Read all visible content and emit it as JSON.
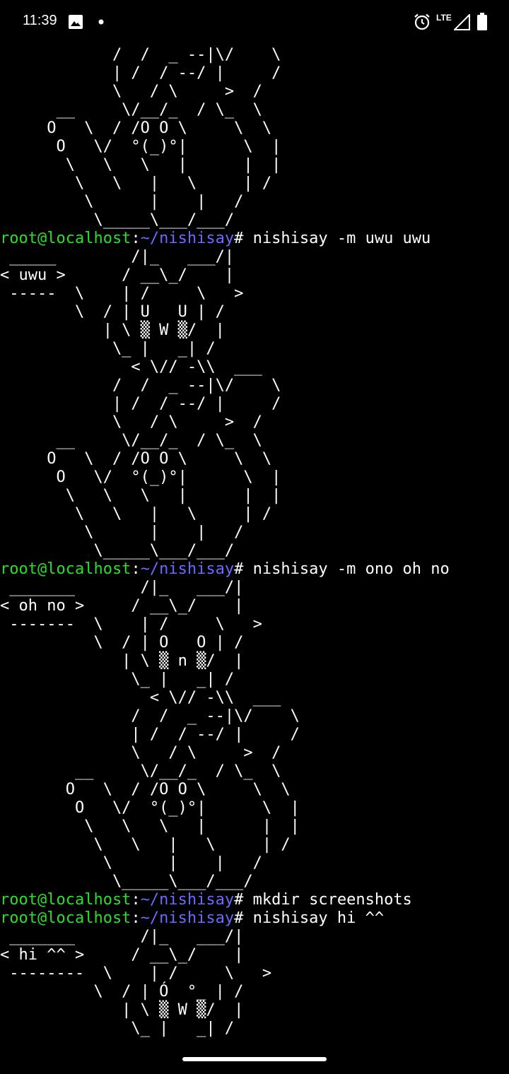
{
  "status_bar": {
    "time": "11:39",
    "network_label": "LTE",
    "icons": [
      "gallery-icon",
      "dot-icon",
      "alarm-icon",
      "signal-icon",
      "battery-icon"
    ]
  },
  "colors": {
    "background": "#000000",
    "text": "#ffffff",
    "prompt_user": "#2adf2a",
    "prompt_path": "#6a6aff"
  },
  "terminal": {
    "lines": [
      {
        "kind": "ascii",
        "text": "            /  /  _ --|\\/    \\"
      },
      {
        "kind": "ascii",
        "text": "            | /  / --/ |     /"
      },
      {
        "kind": "ascii",
        "text": "            \\   / \\     >  /"
      },
      {
        "kind": "ascii",
        "text": "      __     \\/__/_  / \\_  \\"
      },
      {
        "kind": "ascii",
        "text": "     O   \\  / /O O \\     \\  \\"
      },
      {
        "kind": "ascii",
        "text": "      O   \\/  °(_)°|      \\  |"
      },
      {
        "kind": "ascii",
        "text": "       \\   \\   \\   |      |  |"
      },
      {
        "kind": "ascii",
        "text": "        \\   \\   |   \\     | /"
      },
      {
        "kind": "ascii",
        "text": "         \\      |    |   /"
      },
      {
        "kind": "ascii",
        "text": "          \\_____\\___/___/"
      },
      {
        "kind": "prompt",
        "user": "root@localhost",
        "sep": ":",
        "path": "~/nishisay",
        "symbol": "#",
        "command": " nishisay -m uwu uwu"
      },
      {
        "kind": "ascii",
        "text": " _____        /|_   ___/|"
      },
      {
        "kind": "ascii",
        "text": "< uwu >      / __\\_/    |"
      },
      {
        "kind": "ascii",
        "text": " -----  \\    | /     \\   >"
      },
      {
        "kind": "ascii",
        "text": "        \\  / | U   U | /"
      },
      {
        "kind": "ascii",
        "text": "           | \\ ▒ W ▒/  |"
      },
      {
        "kind": "ascii",
        "text": "            \\_ |   _| /"
      },
      {
        "kind": "ascii",
        "text": "              < \\// -\\\\  ___"
      },
      {
        "kind": "ascii",
        "text": "            /  /  _ --|\\/    \\"
      },
      {
        "kind": "ascii",
        "text": "            | /  / --/ |     /"
      },
      {
        "kind": "ascii",
        "text": "            \\   / \\     >  /"
      },
      {
        "kind": "ascii",
        "text": "      __     \\/__/_  / \\_  \\"
      },
      {
        "kind": "ascii",
        "text": "     O   \\  / /O O \\     \\  \\"
      },
      {
        "kind": "ascii",
        "text": "      O   \\/  °(_)°|      \\  |"
      },
      {
        "kind": "ascii",
        "text": "       \\   \\   \\   |      |  |"
      },
      {
        "kind": "ascii",
        "text": "        \\   \\   |   \\     | /"
      },
      {
        "kind": "ascii",
        "text": "         \\      |    |   /"
      },
      {
        "kind": "ascii",
        "text": "          \\_____\\___/___/"
      },
      {
        "kind": "prompt",
        "user": "root@localhost",
        "sep": ":",
        "path": "~/nishisay",
        "symbol": "#",
        "command": " nishisay -m ono oh no"
      },
      {
        "kind": "ascii",
        "text": " _______       /|_   ___/|"
      },
      {
        "kind": "ascii",
        "text": "< oh no >     / __\\_/    |"
      },
      {
        "kind": "ascii",
        "text": " -------  \\    | /     \\   >"
      },
      {
        "kind": "ascii",
        "text": "          \\  / | O   O | /"
      },
      {
        "kind": "ascii",
        "text": "             | \\ ▒ n ▒/  |"
      },
      {
        "kind": "ascii",
        "text": "              \\_ |   _| /"
      },
      {
        "kind": "ascii",
        "text": "                < \\// -\\\\  ___"
      },
      {
        "kind": "ascii",
        "text": "              /  /  _ --|\\/    \\"
      },
      {
        "kind": "ascii",
        "text": "              | /  / --/ |     /"
      },
      {
        "kind": "ascii",
        "text": "              \\   / \\     >  /"
      },
      {
        "kind": "ascii",
        "text": "        __     \\/__/_  / \\_  \\"
      },
      {
        "kind": "ascii",
        "text": "       O   \\  / /O O \\     \\  \\"
      },
      {
        "kind": "ascii",
        "text": "        O   \\/  °(_)°|      \\  |"
      },
      {
        "kind": "ascii",
        "text": "         \\   \\   \\   |      |  |"
      },
      {
        "kind": "ascii",
        "text": "          \\   \\   |   \\     | /"
      },
      {
        "kind": "ascii",
        "text": "           \\      |    |   /"
      },
      {
        "kind": "ascii",
        "text": "            \\_____\\___/___/"
      },
      {
        "kind": "prompt",
        "user": "root@localhost",
        "sep": ":",
        "path": "~/nishisay",
        "symbol": "#",
        "command": " mkdir screenshots"
      },
      {
        "kind": "prompt",
        "user": "root@localhost",
        "sep": ":",
        "path": "~/nishisay",
        "symbol": "#",
        "command": " nishisay hi ^^"
      },
      {
        "kind": "ascii",
        "text": " _______       /|_   ___/|"
      },
      {
        "kind": "ascii",
        "text": "< hi ^^ >     / __\\_/    |"
      },
      {
        "kind": "ascii",
        "text": " --------  \\    | /     \\   >"
      },
      {
        "kind": "ascii",
        "text": "          \\  / | Ó  °_ | /"
      },
      {
        "kind": "ascii",
        "text": "             | \\ ▒ W ▒/  |"
      },
      {
        "kind": "ascii",
        "text": "              \\_ |   _| /"
      }
    ]
  }
}
